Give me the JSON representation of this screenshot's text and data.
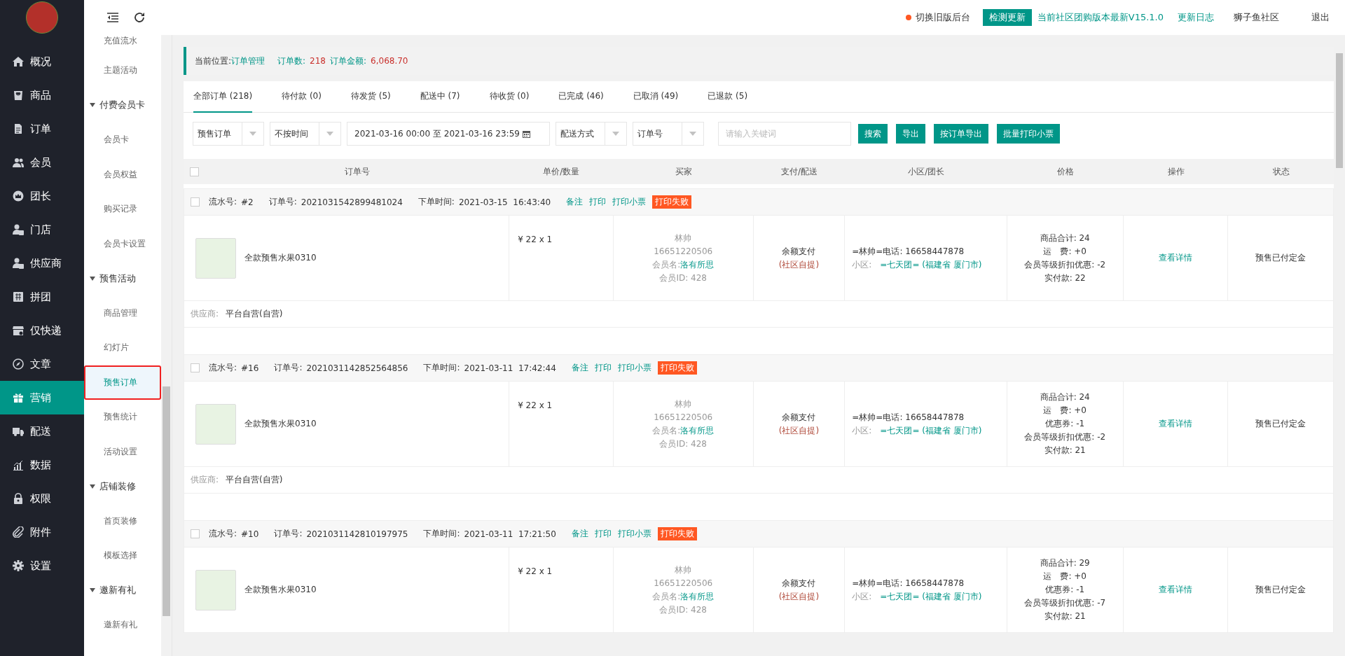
{
  "sidebar": {
    "items": [
      {
        "label": "概况",
        "selected": false
      },
      {
        "label": "商品",
        "selected": false
      },
      {
        "label": "订单",
        "selected": false
      },
      {
        "label": "会员",
        "selected": false
      },
      {
        "label": "团长",
        "selected": false
      },
      {
        "label": "门店",
        "selected": false
      },
      {
        "label": "供应商",
        "selected": false
      },
      {
        "label": "拼团",
        "selected": false
      },
      {
        "label": "仅快递",
        "selected": false
      },
      {
        "label": "文章",
        "selected": false
      },
      {
        "label": "营销",
        "selected": true
      },
      {
        "label": "配送",
        "selected": false
      },
      {
        "label": "数据",
        "selected": false
      },
      {
        "label": "权限",
        "selected": false
      },
      {
        "label": "附件",
        "selected": false
      },
      {
        "label": "设置",
        "selected": false
      }
    ]
  },
  "submenu": {
    "items": [
      {
        "label": "充值流水",
        "selected": false
      },
      {
        "label": "主题活动",
        "selected": false
      },
      {
        "label": "付费会员卡",
        "expanded": true,
        "children": [
          {
            "label": "会员卡",
            "selected": false
          },
          {
            "label": "会员权益",
            "selected": false
          },
          {
            "label": "购买记录",
            "selected": false
          },
          {
            "label": "会员卡设置",
            "selected": false
          }
        ]
      },
      {
        "label": "预售活动",
        "expanded": true,
        "children": [
          {
            "label": "商品管理",
            "selected": false
          },
          {
            "label": "幻灯片",
            "selected": false
          },
          {
            "label": "预售订单",
            "selected": true
          },
          {
            "label": "预售统计",
            "selected": false
          },
          {
            "label": "活动设置",
            "selected": false
          }
        ]
      },
      {
        "label": "店铺装修",
        "expanded": true,
        "children": [
          {
            "label": "首页装修",
            "selected": false
          },
          {
            "label": "模板选择",
            "selected": false
          }
        ]
      },
      {
        "label": "邀新有礼",
        "expanded": true,
        "children": [
          {
            "label": "邀新有礼",
            "selected": false
          }
        ]
      }
    ]
  },
  "topbar": {
    "switch_link": "切换旧版后台",
    "update_button": "检测更新",
    "version_text": "当前社区团购版本最新V15.1.0",
    "changelog_link": "更新日志",
    "community": "狮子鱼社区",
    "logout": "退出"
  },
  "breadcrumb": {
    "label": "当前位置:",
    "current": "订单管理",
    "count_label": "订单数:",
    "count": "218",
    "amount_label": "订单金额:",
    "amount": "6,068.70"
  },
  "tabs": [
    {
      "label": "全部订单 (218)",
      "selected": true
    },
    {
      "label": "待付款 (0)",
      "selected": false
    },
    {
      "label": "待发货 (5)",
      "selected": false
    },
    {
      "label": "配送中 (7)",
      "selected": false
    },
    {
      "label": "待收货 (0)",
      "selected": false
    },
    {
      "label": "已完成 (46)",
      "selected": false
    },
    {
      "label": "已取消 (49)",
      "selected": false
    },
    {
      "label": "已退款 (5)",
      "selected": false
    }
  ],
  "filters": [
    {
      "kind": "select",
      "value": "预售订单"
    },
    {
      "kind": "select",
      "value": "不按时间"
    },
    {
      "kind": "date",
      "value": "2021-03-16 00:00 至 2021-03-16 23:59"
    },
    {
      "kind": "select",
      "value": "配送方式"
    },
    {
      "kind": "select",
      "value": "订单号"
    },
    {
      "kind": "input",
      "placeholder": "请输入关键词"
    }
  ],
  "buttons": [
    "搜索",
    "导出",
    "按订单导出",
    "批量打印小票"
  ],
  "table": {
    "select_all_checked": false,
    "columns": [
      "订单号",
      "单价/数量",
      "买家",
      "支付/配送",
      "小区/团长",
      "价格",
      "操作",
      "状态"
    ],
    "orders": [
      {
        "checked": false,
        "fields": [
          {
            "label": "流水号:",
            "value": "#2"
          },
          {
            "label": "订单号:",
            "value": "2021031542899481024"
          },
          {
            "label": "下单时间:",
            "value": "2021-03-15  16:43:40"
          }
        ],
        "actions": [
          "备注",
          "打印",
          "打印小票"
        ],
        "print_status": "打印失败",
        "product": "全款预售水果0310",
        "price_qty": "¥ 22 x 1",
        "buyer": {
          "name": "林帅",
          "phone": "16651220506",
          "member_label": "会员名:",
          "member_name": "洛有所思",
          "member_id": "会员ID: 428"
        },
        "payment": {
          "method": "余额支付",
          "delivery": "(社区自提)"
        },
        "community": {
          "leader": "=林帅=电话: 16658447878",
          "area_label": "小区:",
          "area": "=七天团= (福建省 厦门市)"
        },
        "price_lines": [
          "商品合计: 24",
          "运　费: +0",
          "会员等级折扣优惠: -2",
          "实付款: 22"
        ],
        "detail_link": "查看详情",
        "status": "预售已付定金",
        "supplier_label": "供应商:",
        "supplier": "平台自营(自营)"
      },
      {
        "checked": false,
        "fields": [
          {
            "label": "流水号:",
            "value": "#16"
          },
          {
            "label": "订单号:",
            "value": "2021031142852564856"
          },
          {
            "label": "下单时间:",
            "value": "2021-03-11  17:42:44"
          }
        ],
        "actions": [
          "备注",
          "打印",
          "打印小票"
        ],
        "print_status": "打印失败",
        "product": "全款预售水果0310",
        "price_qty": "¥ 22 x 1",
        "buyer": {
          "name": "林帅",
          "phone": "16651220506",
          "member_label": "会员名:",
          "member_name": "洛有所思",
          "member_id": "会员ID: 428"
        },
        "payment": {
          "method": "余额支付",
          "delivery": "(社区自提)"
        },
        "community": {
          "leader": "=林帅=电话: 16658447878",
          "area_label": "小区:",
          "area": "=七天团= (福建省 厦门市)"
        },
        "price_lines": [
          "商品合计: 24",
          "运　费: +0",
          "优惠券: -1",
          "会员等级折扣优惠: -2",
          "实付款: 21"
        ],
        "detail_link": "查看详情",
        "status": "预售已付定金",
        "supplier_label": "供应商:",
        "supplier": "平台自营(自营)"
      },
      {
        "checked": false,
        "fields": [
          {
            "label": "流水号:",
            "value": "#10"
          },
          {
            "label": "订单号:",
            "value": "2021031142810197975"
          },
          {
            "label": "下单时间:",
            "value": "2021-03-11  17:21:50"
          }
        ],
        "actions": [
          "备注",
          "打印",
          "打印小票"
        ],
        "print_status": "打印失败",
        "product": "全款预售水果0310",
        "price_qty": "¥ 22 x 1",
        "buyer": {
          "name": "林帅",
          "phone": "16651220506",
          "member_label": "会员名:",
          "member_name": "洛有所思",
          "member_id": "会员ID: 428"
        },
        "payment": {
          "method": "余额支付",
          "delivery": "(社区自提)"
        },
        "community": {
          "leader": "=林帅=电话: 16658447878",
          "area_label": "小区:",
          "area": "=七天团= (福建省 厦门市)"
        },
        "price_lines": [
          "商品合计: 29",
          "运　费: +0",
          "优惠券: -1",
          "会员等级折扣优惠: -7",
          "实付款: 21"
        ],
        "detail_link": "查看详情",
        "status": "预售已付定金"
      }
    ]
  }
}
